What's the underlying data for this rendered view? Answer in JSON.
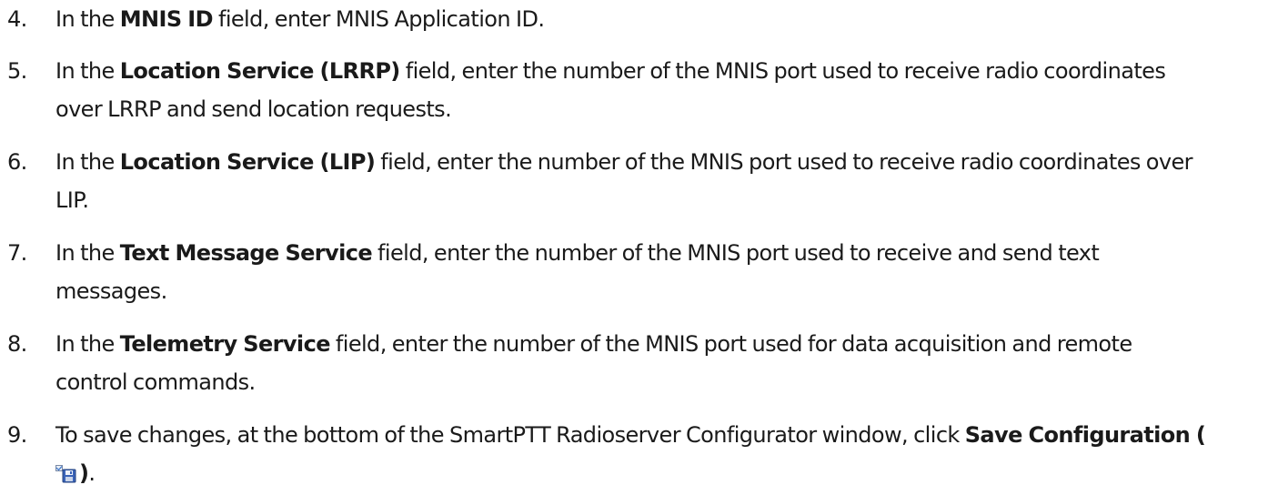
{
  "steps": [
    {
      "number": "4.",
      "lines": [
        {
          "pre": "In the ",
          "bold": "MNIS ID",
          "post": " field, enter MNIS Application ID."
        }
      ]
    },
    {
      "number": "5.",
      "lines": [
        {
          "pre": "In the ",
          "bold": "Location Service (LRRP)",
          "post": " field, enter the number of the MNIS port used to receive radio coordinates"
        },
        {
          "text": "over LRRP and send location requests."
        }
      ]
    },
    {
      "number": "6.",
      "lines": [
        {
          "pre": "In the ",
          "bold": "Location Service (LIP)",
          "post": " field, enter the number of the MNIS port used to receive radio coordinates over"
        },
        {
          "text": "LIP."
        }
      ]
    },
    {
      "number": "7.",
      "lines": [
        {
          "pre": "In the ",
          "bold": "Text Message Service",
          "post": " field, enter the number of the MNIS port used to receive and send text"
        },
        {
          "text": "messages."
        }
      ]
    },
    {
      "number": "8.",
      "lines": [
        {
          "pre": "In the ",
          "bold": "Telemetry Service",
          "post": " field, enter the number of the MNIS port used for data acquisition and remote"
        },
        {
          "text": "control commands."
        }
      ]
    },
    {
      "number": "9.",
      "lines": [
        {
          "pre": "To save changes, at the bottom of the SmartPTT Radioserver Configurator window, click ",
          "bold": "Save Configuration (",
          "post": ""
        },
        {
          "icon": "save-configuration-icon",
          "bold_after": ")",
          "text_after": "."
        }
      ]
    }
  ]
}
